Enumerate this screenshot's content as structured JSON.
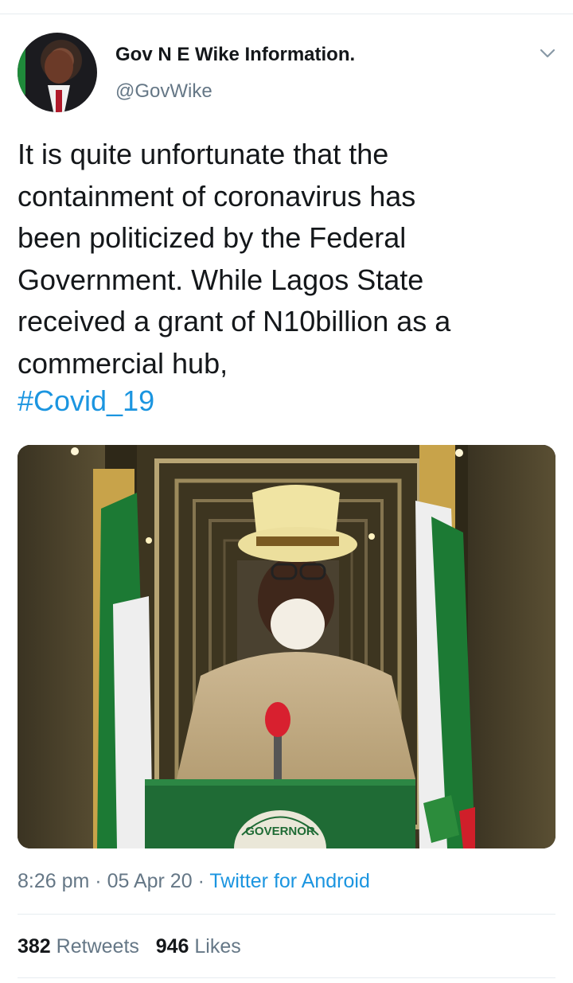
{
  "tweet": {
    "display_name": "Gov N E Wike Information.",
    "handle": "@GovWike",
    "text_lines": [
      "It is quite unfortunate that the",
      "containment of coronavirus has",
      "been politicized by the Federal",
      "Government. While Lagos State",
      "received a grant of N10billion as a",
      "commercial hub,"
    ],
    "hashtag": "#Covid_19",
    "time": "8:26 pm",
    "date": "05 Apr 20",
    "source": "Twitter for Android",
    "separator": "·",
    "retweets_count": "382",
    "retweets_label": "Retweets",
    "likes_count": "946",
    "likes_label": "Likes"
  },
  "media": {
    "podium_text": "GOVERNOR"
  },
  "colors": {
    "link": "#1b95e0",
    "secondary_text": "#657786",
    "primary_text": "#14171a",
    "divider": "#e6ecf0"
  },
  "icons": {
    "menu": "chevron-down-icon"
  }
}
